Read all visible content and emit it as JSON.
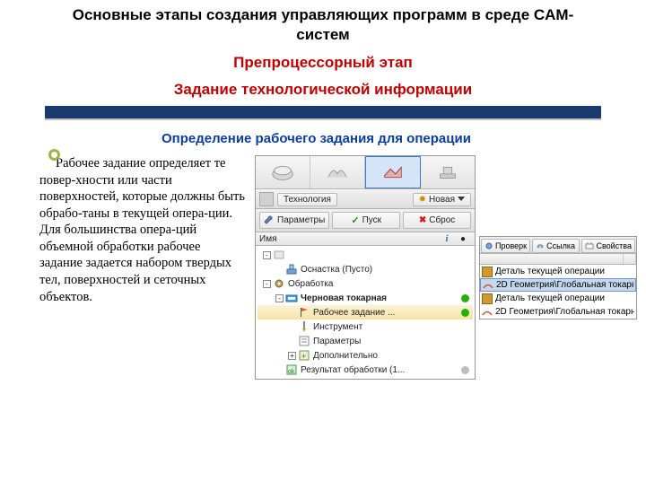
{
  "title_main": "Основные этапы создания управляющих программ в среде CAM-систем",
  "title_stage": "Препроцессорный этап",
  "title_task": "Задание технологической информации",
  "subtitle": "Определение рабочего задания для операции",
  "body": {
    "p1": "Рабочее задание определяет те повер-хности или части поверхностей, которые должны быть обрабо-таны в текущей опера-ции.",
    "p2": "Для большинства опера-ций объемной обработки рабочее задание задается набором твердых тел, поверхностей и сеточных объектов."
  },
  "panel": {
    "tab_label": "Технология",
    "new_btn": "Новая",
    "btn_params": "Параметры",
    "btn_run": "Пуск",
    "btn_reset": "Сброс",
    "col_name": "Имя",
    "tree": [
      {
        "indent": 0,
        "exp": "-",
        "icon": "blank",
        "label": "",
        "status": ""
      },
      {
        "indent": 1,
        "exp": "",
        "icon": "fixture",
        "label": "Оснастка (Пусто)",
        "status": ""
      },
      {
        "indent": 0,
        "exp": "-",
        "icon": "gear",
        "label": "Обработка",
        "status": ""
      },
      {
        "indent": 1,
        "exp": "-",
        "icon": "op",
        "label": "Черновая токарная",
        "status": "green",
        "bold": true
      },
      {
        "indent": 2,
        "exp": "",
        "icon": "flag",
        "label": "Рабочее задание ...",
        "status": "green",
        "sel": true
      },
      {
        "indent": 2,
        "exp": "",
        "icon": "tool",
        "label": "Инструмент",
        "status": ""
      },
      {
        "indent": 2,
        "exp": "",
        "icon": "params",
        "label": "Параметры",
        "status": ""
      },
      {
        "indent": 2,
        "exp": "+",
        "icon": "extra",
        "label": "Дополнительно",
        "status": ""
      },
      {
        "indent": 1,
        "exp": "",
        "icon": "result",
        "label": "Результат обработки (1...",
        "status": "gray"
      }
    ]
  },
  "panel2": {
    "tabs": [
      "Проверк",
      "Ссылка",
      "Свойства"
    ],
    "items": [
      {
        "icon": "cube",
        "label": "Деталь текущей операции",
        "sel": false
      },
      {
        "icon": "surf",
        "label": "2D Геометрия\\Глобальная токарн...",
        "sel": true
      },
      {
        "icon": "cube",
        "label": "Деталь текущей операции",
        "sel": false
      },
      {
        "icon": "surf",
        "label": "2D Геометрия\\Глобальная токарн...",
        "sel": false
      }
    ]
  }
}
